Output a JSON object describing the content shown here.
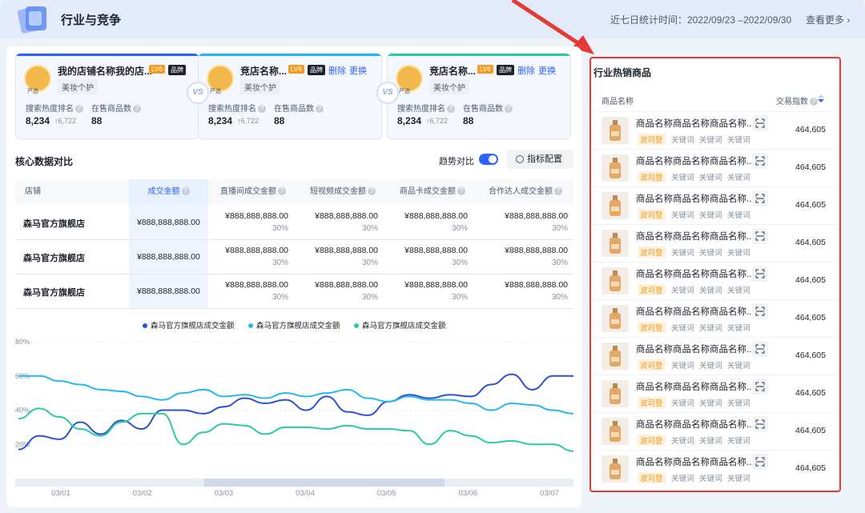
{
  "header": {
    "title": "行业与竞争",
    "stat_time": "近七日统计时间：2022/09/23 –2022/09/30",
    "more": "查看更多 ›"
  },
  "cards": [
    {
      "name": "我的店铺名称我的店...",
      "lv": "LV6",
      "brand": "品牌",
      "category": "美妆个护",
      "avatar_sub": "严选",
      "rank_label": "搜索热度排名",
      "rank_value": "8,234",
      "rank_delta": "6,722",
      "goods_label": "在售商品数",
      "goods_value": "88",
      "accent": "#2c63ff"
    },
    {
      "name": "竞店名称...",
      "lv": "LV6",
      "brand": "品牌",
      "category": "美妆个护",
      "avatar_sub": "严选",
      "del": "删除",
      "chg": "更换",
      "rank_label": "搜索热度排名",
      "rank_value": "8,234",
      "rank_delta": "6,722",
      "goods_label": "在售商品数",
      "goods_value": "88",
      "accent": "#22b5ea"
    },
    {
      "name": "竞店名称...",
      "lv": "LV6",
      "brand": "品牌",
      "category": "美妆个护",
      "avatar_sub": "严选",
      "del": "删除",
      "chg": "更换",
      "rank_label": "搜索热度排名",
      "rank_value": "8,234",
      "rank_delta": "6,722",
      "goods_label": "在售商品数",
      "goods_value": "88",
      "accent": "#2cc9a5"
    }
  ],
  "vs": "VS",
  "core": {
    "title": "核心数据对比",
    "trend_label": "趋势对比",
    "config_label": "指标配置",
    "trend_on": true
  },
  "table": {
    "headers": [
      "店铺",
      "成交金额",
      "直播间成交金额",
      "短视频成交金额",
      "商品卡成交金额",
      "合作达人成交金额"
    ],
    "rows": [
      {
        "store": "森马官方旗舰店",
        "main": "¥888,888,888.00",
        "cells": [
          "¥888,888,888.00",
          "¥888,888,888.00",
          "¥888,888,888.00",
          "¥888,888,888.00"
        ],
        "pct": "30%"
      },
      {
        "store": "森马官方旗舰店",
        "main": "¥888,888,888.00",
        "cells": [
          "¥888,888,888.00",
          "¥888,888,888.00",
          "¥888,888,888.00",
          "¥888,888,888.00"
        ],
        "pct": "30%"
      },
      {
        "store": "森马官方旗舰店",
        "main": "¥888,888,888.00",
        "cells": [
          "¥888,888,888.00",
          "¥888,888,888.00",
          "¥888,888,888.00",
          "¥888,888,888.00"
        ],
        "pct": "30%"
      }
    ]
  },
  "legend": [
    {
      "name": "森马官方旗舰店成交金额",
      "color": "#2c4fd6"
    },
    {
      "name": "森马官方旗舰店成交金额",
      "color": "#25b8f0"
    },
    {
      "name": "森马官方旗舰店成交金额",
      "color": "#2cc9a5"
    }
  ],
  "chart_data": {
    "type": "line",
    "x": [
      "03/01",
      "03/02",
      "03/03",
      "03/04",
      "03/05",
      "03/06",
      "03/07"
    ],
    "yticks": [
      "80%",
      "60%",
      "40%",
      "20%"
    ],
    "ylim": [
      0,
      80
    ],
    "series": [
      {
        "name": "森马官方旗舰店成交金额",
        "color": "#2c4fd6",
        "values": [
          17,
          25,
          23,
          33,
          26,
          34,
          29,
          40,
          40,
          38,
          42,
          47,
          44,
          46,
          40,
          48,
          39,
          37,
          45,
          49,
          47,
          49,
          48,
          55,
          61,
          52,
          60,
          60
        ]
      },
      {
        "name": "森马官方旗舰店成交金额",
        "color": "#25b8f0",
        "values": [
          60,
          60,
          57,
          55,
          52,
          51,
          48,
          46,
          50,
          52,
          48,
          49,
          47,
          50,
          48,
          50,
          52,
          47,
          45,
          48,
          46,
          46,
          44,
          40,
          44,
          43,
          40,
          38
        ]
      },
      {
        "name": "森马官方旗舰店成交金额",
        "color": "#2cc9a5",
        "values": [
          35,
          41,
          36,
          29,
          25,
          33,
          38,
          38,
          20,
          27,
          32,
          31,
          26,
          30,
          30,
          29,
          31,
          29,
          29,
          28,
          20,
          28,
          25,
          21,
          22,
          20,
          20,
          16
        ]
      }
    ]
  },
  "hot": {
    "title": "行业热销商品",
    "col_name": "商品名称",
    "col_index": "交易指数",
    "items": [
      {
        "name": "商品名称商品名称商品名称...",
        "tag": "波司登",
        "kw1": "关键词",
        "kw2": "关键词",
        "kw3": "关键词",
        "value": "464,605"
      },
      {
        "name": "商品名称商品名称商品名称...",
        "tag": "波司登",
        "kw1": "关键词",
        "kw2": "关键词",
        "kw3": "关键词",
        "value": "464,605"
      },
      {
        "name": "商品名称商品名称商品名称...",
        "tag": "波司登",
        "kw1": "关键词",
        "kw2": "关键词",
        "kw3": "关键词",
        "value": "464,605"
      },
      {
        "name": "商品名称商品名称商品名称...",
        "tag": "波司登",
        "kw1": "关键词",
        "kw2": "关键词",
        "kw3": "关键词",
        "value": "464,605"
      },
      {
        "name": "商品名称商品名称商品名称...",
        "tag": "波司登",
        "kw1": "关键词",
        "kw2": "关键词",
        "kw3": "关键词",
        "value": "464,605"
      },
      {
        "name": "商品名称商品名称商品名称...",
        "tag": "波司登",
        "kw1": "关键词",
        "kw2": "关键词",
        "kw3": "关键词",
        "value": "464,605"
      },
      {
        "name": "商品名称商品名称商品名称...",
        "tag": "波司登",
        "kw1": "关键词",
        "kw2": "关键词",
        "kw3": "关键词",
        "value": "464,605"
      },
      {
        "name": "商品名称商品名称商品名称...",
        "tag": "波司登",
        "kw1": "关键词",
        "kw2": "关键词",
        "kw3": "关键词",
        "value": "464,605"
      },
      {
        "name": "商品名称商品名称商品名称...",
        "tag": "波司登",
        "kw1": "关键词",
        "kw2": "关键词",
        "kw3": "关键词",
        "value": "464,605"
      },
      {
        "name": "商品名称商品名称商品名称...",
        "tag": "波司登",
        "kw1": "关键词",
        "kw2": "关键词",
        "kw3": "关键词",
        "value": "464,605"
      }
    ]
  },
  "highlight_color": "#e53935"
}
